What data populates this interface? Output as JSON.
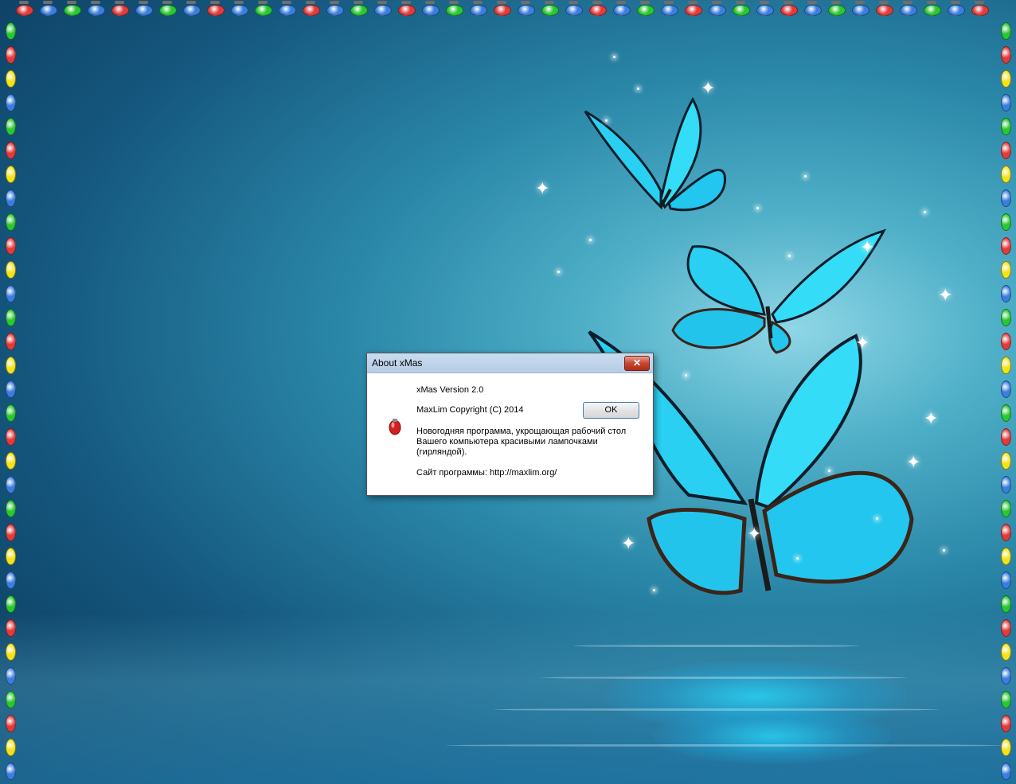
{
  "desktop": {
    "garland_colors": [
      "#29c832",
      "#e23b3b",
      "#f4e21a",
      "#3a7fe0"
    ],
    "icons": {
      "app_icon": "red-christmas-bulb-icon",
      "close": "close-icon"
    }
  },
  "dialog": {
    "title": "About xMas",
    "close_label": "✕",
    "version": "xMas Version 2.0",
    "copyright": "MaxLim Copyright (C) 2014",
    "description_line1": "Новогодняя программа, укрощающая рабочий стол",
    "description_line2": "Вашего компьютера красивыми лампочками",
    "description_line3": "(гирляндой).",
    "site": "Сайт программы: http://maxlim.org/",
    "ok_label": "OK"
  }
}
